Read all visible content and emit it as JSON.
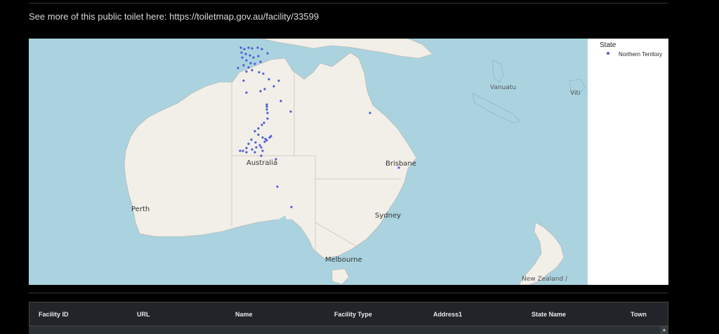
{
  "info_text": "See more of this public toilet here: https://toiletmap.gov.au/facility/33599",
  "map": {
    "places": {
      "vanuatu": "Vanuatu",
      "fiji": "Viti",
      "australia": "Australia",
      "brisbane": "Brisbane",
      "perth": "Perth",
      "sydney": "Sydney",
      "melbourne": "Melbourne",
      "new_zealand": "New Zealand /"
    },
    "info_icon": "i",
    "point_color": "#4f5bd5"
  },
  "legend": {
    "title": "State",
    "items": [
      {
        "label": "Northern Territory",
        "color": "#4f5bd5"
      }
    ]
  },
  "table": {
    "columns": [
      "Facility ID",
      "URL",
      "Name",
      "Facility Type",
      "Address1",
      "State Name",
      "Town"
    ]
  },
  "scrollbar": {
    "up_icon": "▲"
  }
}
